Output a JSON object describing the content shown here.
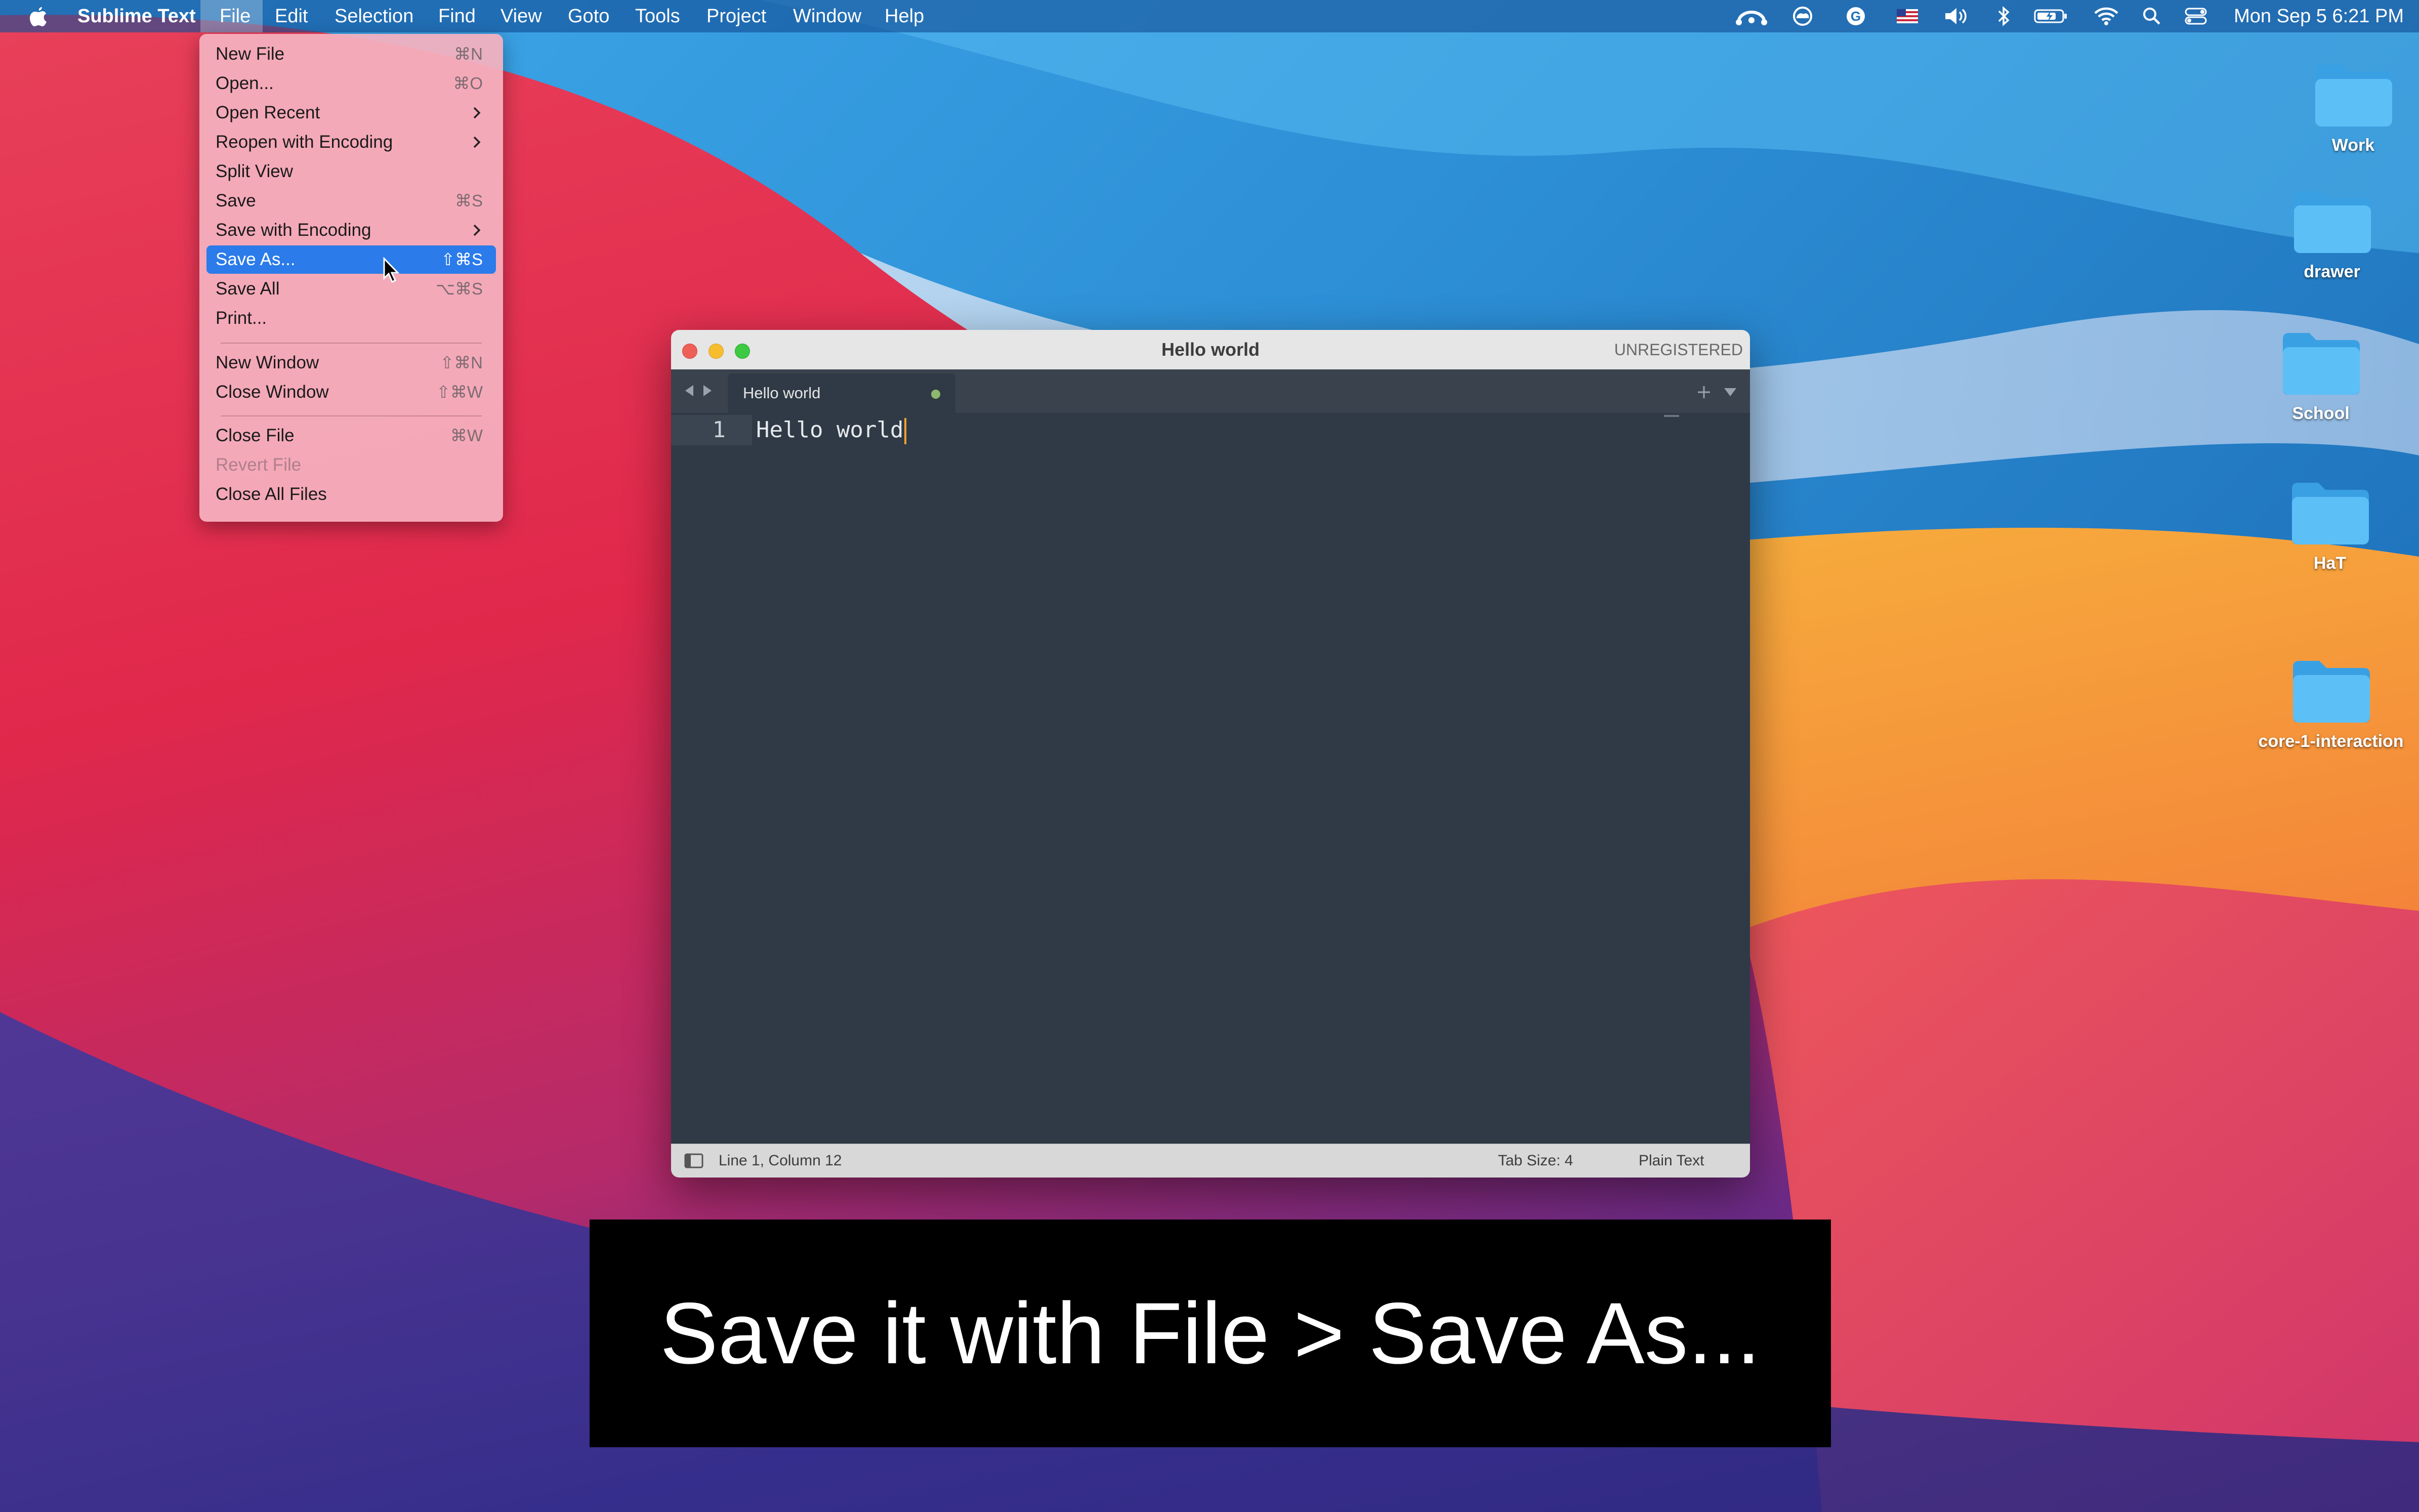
{
  "menubar": {
    "app_name": "Sublime Text",
    "items": [
      "File",
      "Edit",
      "Selection",
      "Find",
      "View",
      "Goto",
      "Tools",
      "Project",
      "Window",
      "Help"
    ],
    "active_item": "File",
    "clock": "Mon Sep 5  6:21 PM",
    "status_icons": [
      "cloud-sync-icon",
      "creative-cloud-icon",
      "grammarly-icon",
      "us-flag-icon",
      "volume-icon",
      "bluetooth-icon",
      "battery-icon",
      "wifi-icon",
      "spotlight-search-icon",
      "control-center-icon"
    ]
  },
  "file_menu": {
    "items": [
      {
        "label": "New File",
        "shortcut": "⌘N"
      },
      {
        "label": "Open...",
        "shortcut": "⌘O"
      },
      {
        "label": "Open Recent",
        "submenu": true
      },
      {
        "label": "Reopen with Encoding",
        "submenu": true
      },
      {
        "label": "Split View"
      },
      {
        "label": "Save",
        "shortcut": "⌘S"
      },
      {
        "label": "Save with Encoding",
        "submenu": true
      },
      {
        "label": "Save As...",
        "shortcut": "⇧⌘S",
        "highlighted": true
      },
      {
        "label": "Save All",
        "shortcut": "⌥⌘S"
      },
      {
        "label": "Print..."
      },
      {
        "label": "New Window",
        "shortcut": "⇧⌘N"
      },
      {
        "label": "Close Window",
        "shortcut": "⇧⌘W"
      },
      {
        "label": "Close File",
        "shortcut": "⌘W"
      },
      {
        "label": "Revert File",
        "disabled": true
      },
      {
        "label": "Close All Files"
      }
    ]
  },
  "editor_window": {
    "title": "Hello world",
    "license_badge": "UNREGISTERED",
    "tab_label": "Hello world",
    "line_number": "1",
    "content": "Hello world",
    "status": {
      "position": "Line 1, Column 12",
      "tab_size": "Tab Size: 4",
      "syntax": "Plain Text"
    }
  },
  "desktop_folders": [
    "Work",
    "drawer",
    "School",
    "HaT",
    "core-1-interaction"
  ],
  "caption": "Save it with File > Save As...",
  "colors": {
    "menu_highlight": "#2b7bea",
    "editor_bg": "#2f3a46",
    "caret": "#f0a030",
    "folder": "#4bb3f0"
  }
}
